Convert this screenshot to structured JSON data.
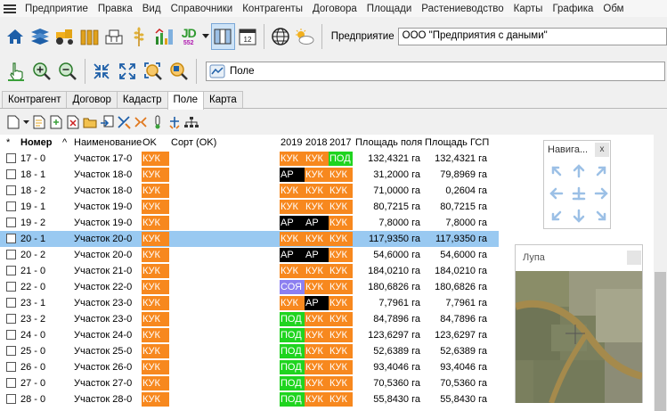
{
  "menu": [
    "Предприятие",
    "Правка",
    "Вид",
    "Справочники",
    "Контрагенты",
    "Договора",
    "Площади",
    "Растениеводство",
    "Карты",
    "Графика",
    "Обм"
  ],
  "toolbar": {
    "enterprise_label": "Предприятие",
    "enterprise_value": "ООО \"Предприятия с даными\"",
    "jd_label": "JD",
    "jd_sub": "552",
    "calendar_day": "12"
  },
  "search_value": "Поле",
  "tabs": [
    "Контрагент",
    "Договор",
    "Кадастр",
    "Поле",
    "Карта"
  ],
  "active_tab": "Поле",
  "grid": {
    "headers": {
      "star": "*",
      "nomer": "Номер",
      "sort_arrow": "^",
      "name": "Наименование",
      "ok": "OK",
      "sort_ok": "Сорт (OK)",
      "y2019": "2019",
      "y2018": "2018",
      "y2017": "2017",
      "area": "Площадь поля",
      "gsp": "Площадь ГСП"
    },
    "rows": [
      {
        "nomer": "17 - 0",
        "name": "Участок 17-0",
        "ok": "КУК",
        "y2019": "КУК",
        "y2018": "КУК",
        "y2017": "ПОД",
        "area": "132,4321 га",
        "gsp": "132,4321 га"
      },
      {
        "nomer": "18 - 1",
        "name": "Участок 18-0",
        "ok": "КУК",
        "y2019": "АР",
        "y2018": "КУК",
        "y2017": "КУК",
        "area": "31,2000 га",
        "gsp": "79,8969 га"
      },
      {
        "nomer": "18 - 2",
        "name": "Участок 18-0",
        "ok": "КУК",
        "y2019": "КУК",
        "y2018": "КУК",
        "y2017": "КУК",
        "area": "71,0000 га",
        "gsp": "0,2604 га"
      },
      {
        "nomer": "19 - 1",
        "name": "Участок 19-0",
        "ok": "КУК",
        "y2019": "КУК",
        "y2018": "КУК",
        "y2017": "КУК",
        "area": "80,7215 га",
        "gsp": "80,7215 га"
      },
      {
        "nomer": "19 - 2",
        "name": "Участок 19-0",
        "ok": "КУК",
        "y2019": "АР",
        "y2018": "АР",
        "y2017": "КУК",
        "area": "7,8000 га",
        "gsp": "7,8000 га"
      },
      {
        "nomer": "20 - 1",
        "name": "Участок 20-0",
        "ok": "КУК",
        "y2019": "КУК",
        "y2018": "КУК",
        "y2017": "КУК",
        "area": "117,9350 га",
        "gsp": "117,9350 га"
      },
      {
        "nomer": "20 - 2",
        "name": "Участок 20-0",
        "ok": "КУК",
        "y2019": "АР",
        "y2018": "АР",
        "y2017": "КУК",
        "area": "54,6000 га",
        "gsp": "54,6000 га"
      },
      {
        "nomer": "21 - 0",
        "name": "Участок 21-0",
        "ok": "КУК",
        "y2019": "КУК",
        "y2018": "КУК",
        "y2017": "КУК",
        "area": "184,0210 га",
        "gsp": "184,0210 га"
      },
      {
        "nomer": "22 - 0",
        "name": "Участок 22-0",
        "ok": "КУК",
        "y2019": "СОЯ",
        "y2018": "КУК",
        "y2017": "КУК",
        "area": "180,6826 га",
        "gsp": "180,6826 га"
      },
      {
        "nomer": "23 - 1",
        "name": "Участок 23-0",
        "ok": "КУК",
        "y2019": "КУК",
        "y2018": "АР",
        "y2017": "КУК",
        "area": "7,7961 га",
        "gsp": "7,7961 га"
      },
      {
        "nomer": "23 - 2",
        "name": "Участок 23-0",
        "ok": "КУК",
        "y2019": "ПОД",
        "y2018": "КУК",
        "y2017": "КУК",
        "area": "84,7896 га",
        "gsp": "84,7896 га"
      },
      {
        "nomer": "24 - 0",
        "name": "Участок 24-0",
        "ok": "КУК",
        "y2019": "ПОД",
        "y2018": "КУК",
        "y2017": "КУК",
        "area": "123,6297 га",
        "gsp": "123,6297 га"
      },
      {
        "nomer": "25 - 0",
        "name": "Участок 25-0",
        "ok": "КУК",
        "y2019": "ПОД",
        "y2018": "КУК",
        "y2017": "КУК",
        "area": "52,6389 га",
        "gsp": "52,6389 га"
      },
      {
        "nomer": "26 - 0",
        "name": "Участок 26-0",
        "ok": "КУК",
        "y2019": "ПОД",
        "y2018": "КУК",
        "y2017": "КУК",
        "area": "93,4046 га",
        "gsp": "93,4046 га"
      },
      {
        "nomer": "27 - 0",
        "name": "Участок 27-0",
        "ok": "КУК",
        "y2019": "ПОД",
        "y2018": "КУК",
        "y2017": "КУК",
        "area": "70,5360 га",
        "gsp": "70,5360 га"
      },
      {
        "nomer": "28 - 0",
        "name": "Участок 28-0",
        "ok": "КУК",
        "y2019": "ПОД",
        "y2018": "КУК",
        "y2017": "КУК",
        "area": "55,8430 га",
        "gsp": "55,8430 га"
      }
    ],
    "selected_nomer": "20 - 1"
  },
  "crop_colors": {
    "КУК": "#f7881e",
    "АР": "#000000",
    "ПОД": "#1fd41f",
    "СОЯ": "#8c7ff0"
  },
  "navigator": {
    "title": "Навига...",
    "close": "x"
  },
  "magnifier": {
    "title": "Лупа"
  }
}
